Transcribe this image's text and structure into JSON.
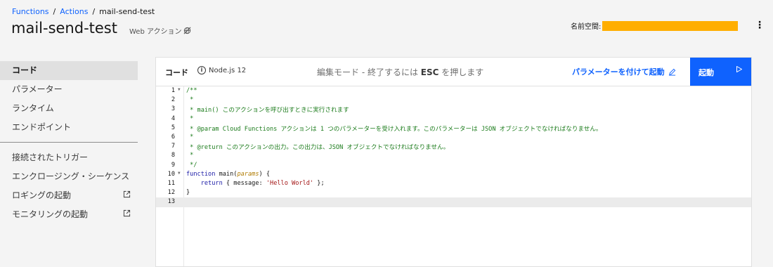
{
  "breadcrumb": {
    "items": [
      "Functions",
      "Actions"
    ],
    "sep": "/",
    "current": "mail-send-test"
  },
  "page": {
    "title": "mail-send-test",
    "action_type": "Web アクション"
  },
  "namespace": {
    "label": "名前空間:"
  },
  "sidebar": {
    "items": [
      {
        "label": "コード"
      },
      {
        "label": "パラメーター"
      },
      {
        "label": "ランタイム"
      },
      {
        "label": "エンドポイント"
      }
    ],
    "items2": [
      {
        "label": "接続されたトリガー"
      },
      {
        "label": "エンクロージング・シーケンス"
      },
      {
        "label": "ロギングの起動"
      },
      {
        "label": "モニタリングの起動"
      }
    ]
  },
  "editor_header": {
    "code_label": "コード",
    "runtime": "Node.js 12",
    "mode_prefix": "編集モード - 終了するには",
    "mode_key": "ESC",
    "mode_suffix": "を押します",
    "invoke_with_params": "パラメーターを付けて起動",
    "invoke": "起動"
  },
  "code": {
    "line_numbers": [
      "1",
      "2",
      "3",
      "4",
      "5",
      "6",
      "7",
      "8",
      "9",
      "10",
      "11",
      "12",
      "13"
    ],
    "lines": [
      "/**",
      " *",
      " * main() このアクションを呼び出すときに実行されます",
      " *",
      " * @param Cloud Functions アクションは 1 つのパラメーターを受け入れます。このパラメーターは JSON オブジェクトでなければなりません。",
      " *",
      " * @return このアクションの出力。この出力は、JSON オブジェクトでなければなりません。",
      " *",
      " */",
      "function main(params) {",
      "    return { message: 'Hello World' };",
      "}",
      ""
    ],
    "tokens": {
      "kw_function": "function",
      "fn_name": " main(",
      "param": "params",
      "after_param": ") {",
      "return_kw": "    return",
      "obj_open": " { message: ",
      "str": "'Hello World'",
      "obj_close": " };",
      "close_brace": "}"
    }
  },
  "colors": {
    "accent": "#0f62fe",
    "namespace_redaction": "#ffae00",
    "comment": "#1c7c1c"
  }
}
